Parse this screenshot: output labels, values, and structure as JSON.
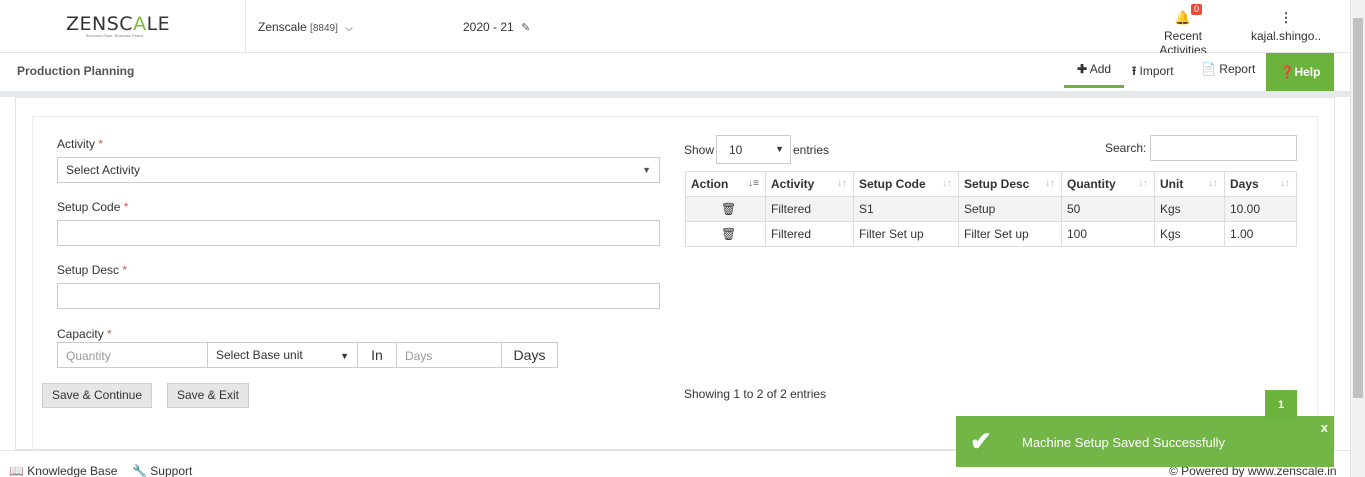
{
  "header": {
    "logo_main": "ZENSCALE",
    "logo_tagline": "Business Ease, Business Peace",
    "company_name": "Zenscale",
    "company_code": "[8849]",
    "fiscal_year": "2020 - 21",
    "recent_label": "Recent Activities",
    "notification_count": "0",
    "user_name": "kajal.shingo.."
  },
  "subheader": {
    "title": "Production Planning",
    "add_label": "Add",
    "import_label": "Import",
    "report_label": "Report",
    "help_label": "Help"
  },
  "form": {
    "activity_label": "Activity",
    "activity_value": "Select Activity",
    "setup_code_label": "Setup Code",
    "setup_code_value": "",
    "setup_desc_label": "Setup Desc",
    "setup_desc_value": "",
    "capacity_label": "Capacity",
    "quantity_placeholder": "Quantity",
    "base_unit_value": "Select Base unit",
    "in_label": "In",
    "days_placeholder": "Days",
    "days_label": "Days",
    "required_mark": "*",
    "save_continue_label": "Save & Continue",
    "save_exit_label": "Save & Exit"
  },
  "table": {
    "show_label": "Show",
    "page_size": "10",
    "entries_label": "entries",
    "search_label": "Search:",
    "columns": [
      "Action",
      "Activity",
      "Setup Code",
      "Setup Desc",
      "Quantity",
      "Unit",
      "Days"
    ],
    "rows": [
      {
        "activity": "Filtered",
        "setup_code": "S1",
        "setup_desc": "Setup",
        "quantity": "50",
        "unit": "Kgs",
        "days": "10.00"
      },
      {
        "activity": "Filtered",
        "setup_code": "Filter Set up",
        "setup_desc": "Filter Set up",
        "quantity": "100",
        "unit": "Kgs",
        "days": "1.00"
      }
    ],
    "info": "Showing 1 to 2 of 2 entries",
    "current_page": "1"
  },
  "toast": {
    "message": "Machine Setup Saved Successfully",
    "close_label": "x"
  },
  "footer": {
    "knowledge_base": "Knowledge Base",
    "support": "Support",
    "powered_by": "© Powered by www.zenscale.in"
  },
  "colors": {
    "accent": "#6cb33e",
    "required": "#d9534f",
    "badge": "#e74c3c"
  }
}
